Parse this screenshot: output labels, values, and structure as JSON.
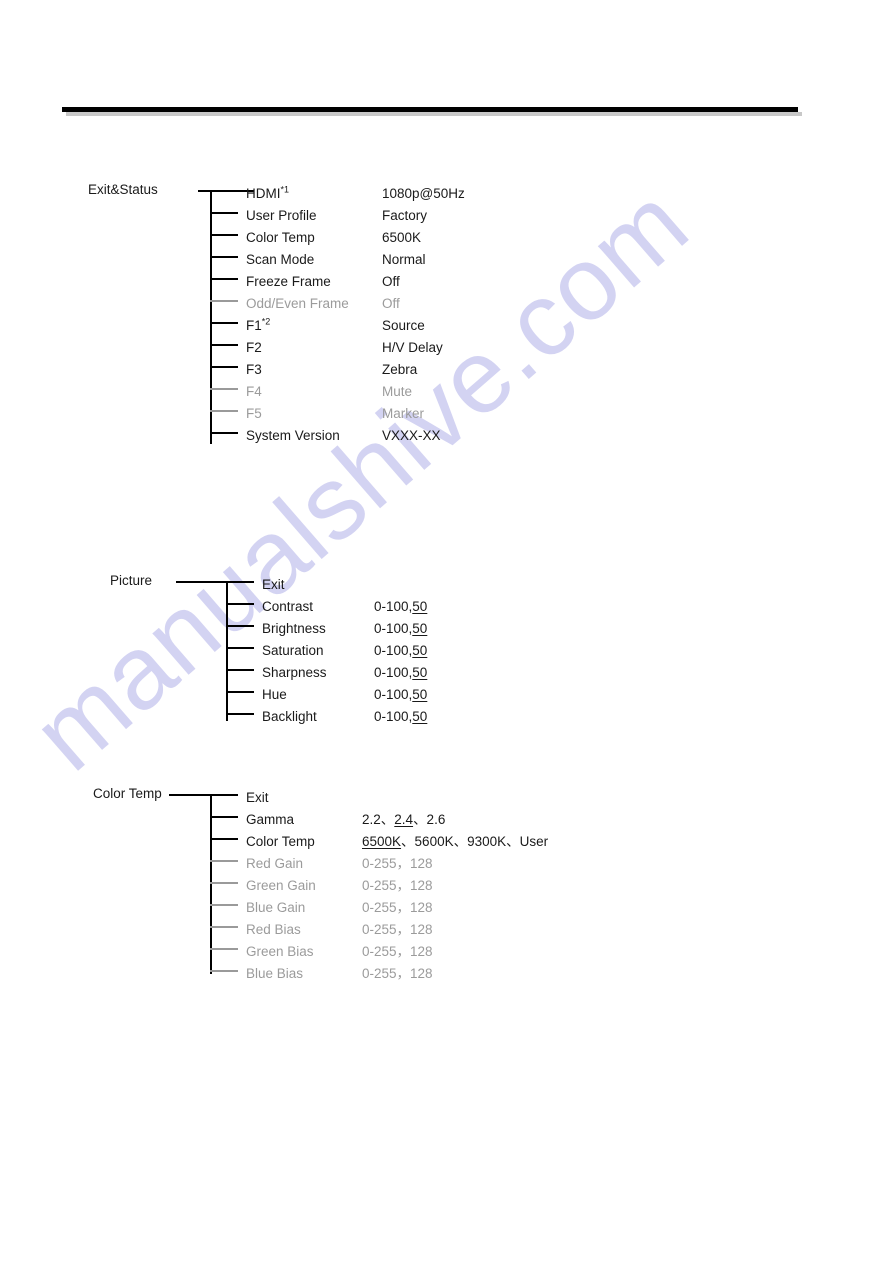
{
  "document": {
    "watermark": "manualshive.com",
    "header_rule": true
  },
  "sections": [
    {
      "id": "exit-status",
      "root_label": "Exit&Status",
      "rows": [
        {
          "name": "HDMI",
          "sup": "*1",
          "value": "1080p@50Hz",
          "dim": false
        },
        {
          "name": "User Profile",
          "sup": "",
          "value": "Factory",
          "dim": false
        },
        {
          "name": "Color Temp",
          "sup": "",
          "value": "6500K",
          "dim": false
        },
        {
          "name": "Scan Mode",
          "sup": "",
          "value": "Normal",
          "dim": false
        },
        {
          "name": "Freeze Frame",
          "sup": "",
          "value": "Off",
          "dim": false
        },
        {
          "name": "Odd/Even Frame",
          "sup": "",
          "value": "Off",
          "dim": true
        },
        {
          "name": "F1",
          "sup": "*2",
          "value": "Source",
          "dim": false
        },
        {
          "name": "F2",
          "sup": "",
          "value": "H/V Delay",
          "dim": false
        },
        {
          "name": "F3",
          "sup": "",
          "value": "Zebra",
          "dim": false
        },
        {
          "name": "F4",
          "sup": "",
          "value": "Mute",
          "dim": true
        },
        {
          "name": "F5",
          "sup": "",
          "value": "Marker",
          "dim": true
        },
        {
          "name": "System Version",
          "sup": "",
          "value": "VXXX-XX",
          "dim": false
        }
      ]
    },
    {
      "id": "picture",
      "root_label": "Picture",
      "rows": [
        {
          "name": "Exit",
          "sup": "",
          "value": "",
          "dim": false
        },
        {
          "name": "Contrast",
          "sup": "",
          "value": "0-100,",
          "value_underlined": "50",
          "dim": false
        },
        {
          "name": "Brightness",
          "sup": "",
          "value": "0-100,",
          "value_underlined": "50",
          "dim": false
        },
        {
          "name": "Saturation",
          "sup": "",
          "value": "0-100,",
          "value_underlined": "50",
          "dim": false
        },
        {
          "name": "Sharpness",
          "sup": "",
          "value": "0-100,",
          "value_underlined": "50",
          "dim": false
        },
        {
          "name": "Hue",
          "sup": "",
          "value": "0-100,",
          "value_underlined": "50",
          "dim": false
        },
        {
          "name": "Backlight",
          "sup": "",
          "value": "0-100,",
          "value_underlined": "50",
          "dim": false
        }
      ]
    },
    {
      "id": "color-temp",
      "root_label": "Color Temp",
      "rows": [
        {
          "name": "Exit",
          "sup": "",
          "value": "",
          "dim": false
        },
        {
          "name": "Gamma",
          "sup": "",
          "value_pre": "2.2、",
          "value_underlined": "2.4",
          "value_post": "、2.6",
          "dim": false
        },
        {
          "name": "Color Temp",
          "sup": "",
          "value_pre": "",
          "value_underlined": "6500K",
          "value_post": "、5600K、9300K、User",
          "dim": false
        },
        {
          "name": "Red Gain",
          "sup": "",
          "value": "0-255，128",
          "dim": true
        },
        {
          "name": "Green Gain",
          "sup": "",
          "value": "0-255，128",
          "dim": true
        },
        {
          "name": "Blue Gain",
          "sup": "",
          "value": "0-255，128",
          "dim": true
        },
        {
          "name": "Red Bias",
          "sup": "",
          "value": "0-255，128",
          "dim": true
        },
        {
          "name": "Green Bias",
          "sup": "",
          "value": "0-255，128",
          "dim": true
        },
        {
          "name": "Blue Bias",
          "sup": "",
          "value": "0-255，128",
          "dim": true
        }
      ]
    }
  ]
}
